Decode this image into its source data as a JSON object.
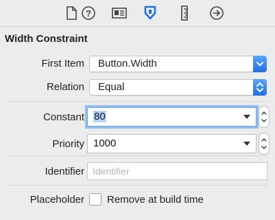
{
  "toolbar": {
    "tabs": [
      {
        "icon": "file-icon"
      },
      {
        "icon": "help-icon"
      },
      {
        "icon": "identity-icon"
      },
      {
        "icon": "attributes-icon",
        "active": true
      },
      {
        "icon": "ruler-icon"
      },
      {
        "icon": "connections-icon"
      }
    ]
  },
  "section": {
    "title": "Width Constraint"
  },
  "first_item": {
    "label": "First Item",
    "value": "Button.Width"
  },
  "relation": {
    "label": "Relation",
    "value": "Equal"
  },
  "constant": {
    "label": "Constant",
    "value": "80"
  },
  "priority": {
    "label": "Priority",
    "value": "1000"
  },
  "identifier": {
    "label": "Identifier",
    "placeholder": "Identifier",
    "value": ""
  },
  "placeholder_row": {
    "label": "Placeholder",
    "checkbox_label": "Remove at build time",
    "checked": false
  },
  "colors": {
    "accent": "#1f6fe6",
    "focus_ring": "#8fbdf2",
    "background": "#ececec"
  }
}
